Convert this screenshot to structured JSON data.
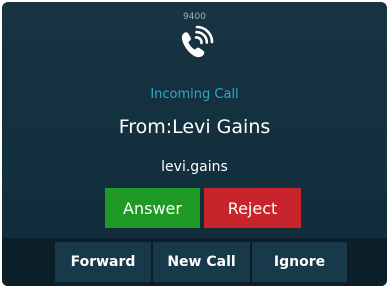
{
  "call": {
    "extension": "9400",
    "status": "Incoming Call",
    "from": "From:Levi Gains",
    "username": "levi.gains"
  },
  "icons": {
    "ringing": "phone-ringing-icon"
  },
  "buttons": {
    "answer": "Answer",
    "reject": "Reject"
  },
  "softkeys": {
    "forward": "Forward",
    "new_call": "New Call",
    "ignore": "Ignore"
  },
  "colors": {
    "background": "#13303f",
    "status_text": "#2ea8c8",
    "answer": "#1e9a25",
    "reject": "#c7242b",
    "softkey": "#17394a"
  }
}
